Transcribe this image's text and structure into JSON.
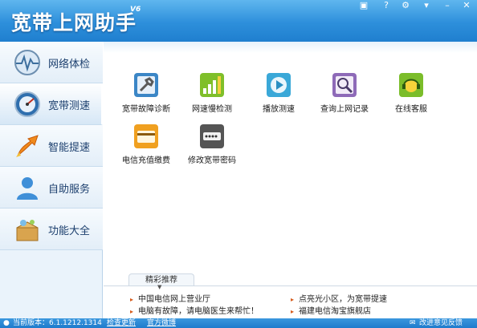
{
  "app": {
    "title": "宽带上网助手",
    "version": "V6"
  },
  "window_controls": [
    "▣",
    "?",
    "⚙",
    "▾",
    "–",
    "✕"
  ],
  "sidebar": {
    "items": [
      {
        "label": "网络体检",
        "icon": "heartbeat-globe-icon"
      },
      {
        "label": "宽带测速",
        "icon": "speedometer-icon"
      },
      {
        "label": "智能提速",
        "icon": "rocket-arrow-icon"
      },
      {
        "label": "自助服务",
        "icon": "user-icon"
      },
      {
        "label": "功能大全",
        "icon": "toolbox-icon"
      }
    ],
    "active_index": 1
  },
  "tools": [
    {
      "label": "宽带故障诊断",
      "icon": "wrench-diagnose-icon",
      "color": "#3b86c6"
    },
    {
      "label": "网速慢检测",
      "icon": "signal-bars-icon",
      "color": "#7fbf2a"
    },
    {
      "label": "播放测速",
      "icon": "play-icon",
      "color": "#3aa8d8"
    },
    {
      "label": "查询上网记录",
      "icon": "magnifier-icon",
      "color": "#8e6ab8"
    },
    {
      "label": "在线客服",
      "icon": "headset-icon",
      "color": "#7bbd2a"
    },
    {
      "label": "电信充值缴费",
      "icon": "card-icon",
      "color": "#f0a020"
    },
    {
      "label": "修改宽带密码",
      "icon": "password-icon",
      "color": "#555555"
    }
  ],
  "recommend": {
    "tab_label": "精彩推荐",
    "links": [
      "中国电信网上营业厅",
      "点亮光小区，为宽带提速",
      "电脑有故障，请电脑医生来帮忙！",
      "福建电信淘宝旗舰店"
    ]
  },
  "status": {
    "version_text": "当前版本：6.1.1212.1314",
    "check_update": "检查更新",
    "official_weibo": "官方微博",
    "feedback": "改进意见反馈"
  }
}
